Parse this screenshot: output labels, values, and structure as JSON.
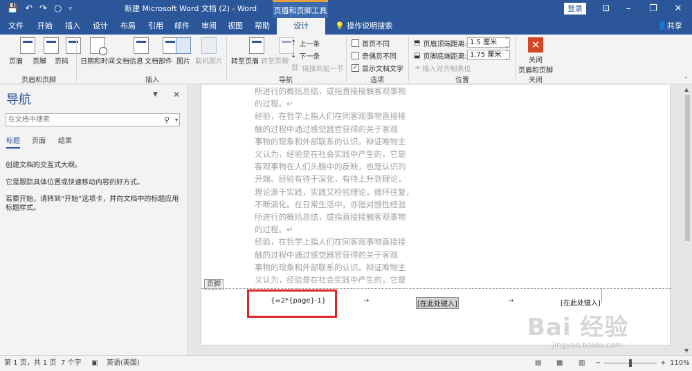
{
  "titlebar": {
    "title": "新建 Microsoft Word 文档 (2)  -  Word",
    "context_tab": "页眉和页脚工具",
    "login": "登录",
    "qat_icons": [
      "save-icon",
      "undo-icon",
      "redo-icon",
      "circle-icon",
      "customize-icon"
    ],
    "accent": "#2b579a"
  },
  "tabs": {
    "items": [
      "文件",
      "开始",
      "插入",
      "设计",
      "布局",
      "引用",
      "邮件",
      "审阅",
      "视图",
      "帮助",
      "设计"
    ],
    "active": "设计",
    "tellme": "操作说明搜索",
    "share": "共享"
  },
  "ribbon": {
    "header_footer": {
      "header": "页眉",
      "footer": "页脚",
      "page_number": "页码",
      "label": "页眉和页脚"
    },
    "insert": {
      "date_time": "日期和时间",
      "doc_info": "文档信息",
      "doc_parts": "文档部件",
      "picture": "图片",
      "online_picture": "联机图片",
      "label": "插入"
    },
    "navigation": {
      "goto_header": "转至页眉",
      "goto_footer": "转至页脚",
      "previous": "上一条",
      "next": "下一条",
      "link_previous": "链接到前一节",
      "label": "导航"
    },
    "options": {
      "diff_first": "首页不同",
      "diff_odd_even": "奇偶页不同",
      "show_doc_text": "显示文档文字",
      "label": "选项"
    },
    "position": {
      "header_top": "页眉顶端距离:",
      "header_top_value": "1.5 厘米",
      "footer_bottom": "页脚底端距离:",
      "footer_bottom_value": "1.75 厘米",
      "insert_align_tab": "插入对齐制表位",
      "label": "位置"
    },
    "close": {
      "close_line1": "关闭",
      "close_line2": "页眉和页脚",
      "label": "关闭"
    }
  },
  "navpane": {
    "title": "导航",
    "search_placeholder": "在文档中搜索",
    "tabs": [
      "标题",
      "页面",
      "结果"
    ],
    "msg1": "创建文档的交互式大纲。",
    "msg2": "它是跟踪具体位置或快速移动内容的好方式。",
    "msg3": "若要开始，请转到“开始”选项卡，并向文档中的标题应用标题样式。"
  },
  "document": {
    "lines": [
      "所进行的概括总结，或指直接接触客观事物",
      "的过程。↵",
      "经验，在哲学上指人们在同客观事物直接接",
      "触的过程中通过感觉器官获得的关于客观",
      "事物的现象和外部联系的认识。辩证唯物主",
      "义认为，经验是在社会实践中产生的，它是",
      "客观事物在人们头脑中的反映，也是认识的",
      "开端。经验有待于深化，有待上升到理论，",
      "理论源于实践，实践又检验理论，循环往复，",
      "不断演化。在日常生活中，亦指对感性经验",
      "所进行的概括总结，或指直接接触客观事物",
      "的过程。↵",
      "经验，在哲学上指人们在同客观事物直接接",
      "触的过程中通过感觉器官获得的关于客观",
      "事物的现象和外部联系的认识。辩证唯物主",
      "义认为，经验是在社会实践中产生的，它是"
    ],
    "footer_tag": "页脚",
    "field_code": "{=2*{page}-1}",
    "tab_arrow": "→",
    "placeholder_center": "[在此处键入]",
    "placeholder_right": "[在此处键入]",
    "highlight_color": "#e02424"
  },
  "statusbar": {
    "page": "第 1 页，共 1 页",
    "words": "7 个字",
    "language": "英语(美国)",
    "zoom": "110%",
    "zoom_minus": "−",
    "zoom_plus": "+"
  },
  "watermark": {
    "brand": "Bai 经验",
    "url": "jingyan.baidu.com"
  }
}
